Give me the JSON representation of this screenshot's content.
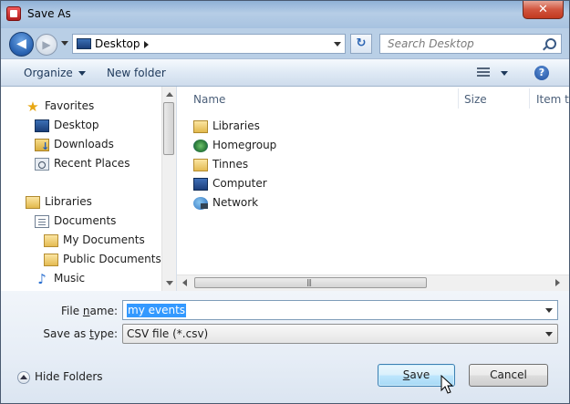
{
  "window": {
    "title": "Save As",
    "close_glyph": "✕"
  },
  "nav": {
    "back_glyph": "◀",
    "forward_glyph": "▶",
    "address": "Desktop",
    "refresh_glyph": "↻",
    "search_placeholder": "Search Desktop"
  },
  "toolbar": {
    "organize_label": "Organize",
    "new_folder_label": "New folder",
    "help_glyph": "?"
  },
  "sidebar": {
    "items": [
      {
        "label": "Favorites",
        "icon": "star-icon"
      },
      {
        "label": "Desktop",
        "icon": "desktop-icon"
      },
      {
        "label": "Downloads",
        "icon": "downloads-icon"
      },
      {
        "label": "Recent Places",
        "icon": "recent-places-icon"
      },
      {
        "label": "Libraries",
        "icon": "libraries-icon"
      },
      {
        "label": "Documents",
        "icon": "documents-icon"
      },
      {
        "label": "My Documents",
        "icon": "folder-icon"
      },
      {
        "label": "Public Documents",
        "icon": "folder-icon"
      },
      {
        "label": "Music",
        "icon": "music-icon"
      }
    ]
  },
  "files": {
    "columns": [
      "Name",
      "Size",
      "Item t"
    ],
    "rows": [
      {
        "name": "Libraries",
        "icon": "libraries-icon"
      },
      {
        "name": "Homegroup",
        "icon": "homegroup-icon"
      },
      {
        "name": "Tinnes",
        "icon": "folder-icon"
      },
      {
        "name": "Computer",
        "icon": "computer-icon"
      },
      {
        "name": "Network",
        "icon": "network-icon"
      }
    ]
  },
  "form": {
    "file_name_label_pre": "File ",
    "file_name_label_u": "n",
    "file_name_label_post": "ame:",
    "file_name_value": "my events",
    "save_as_type_label_pre": "Save as ",
    "save_as_type_label_u": "t",
    "save_as_type_label_post": "ype:",
    "save_as_type_value": "CSV file (*.csv)"
  },
  "footer": {
    "hide_folders_label": "Hide Folders",
    "save_label_u": "S",
    "save_label_rest": "ave",
    "cancel_label": "Cancel"
  },
  "colors": {
    "selection": "#3399ff",
    "titlebar": "#b6cde6",
    "accent": "#1e395b"
  }
}
